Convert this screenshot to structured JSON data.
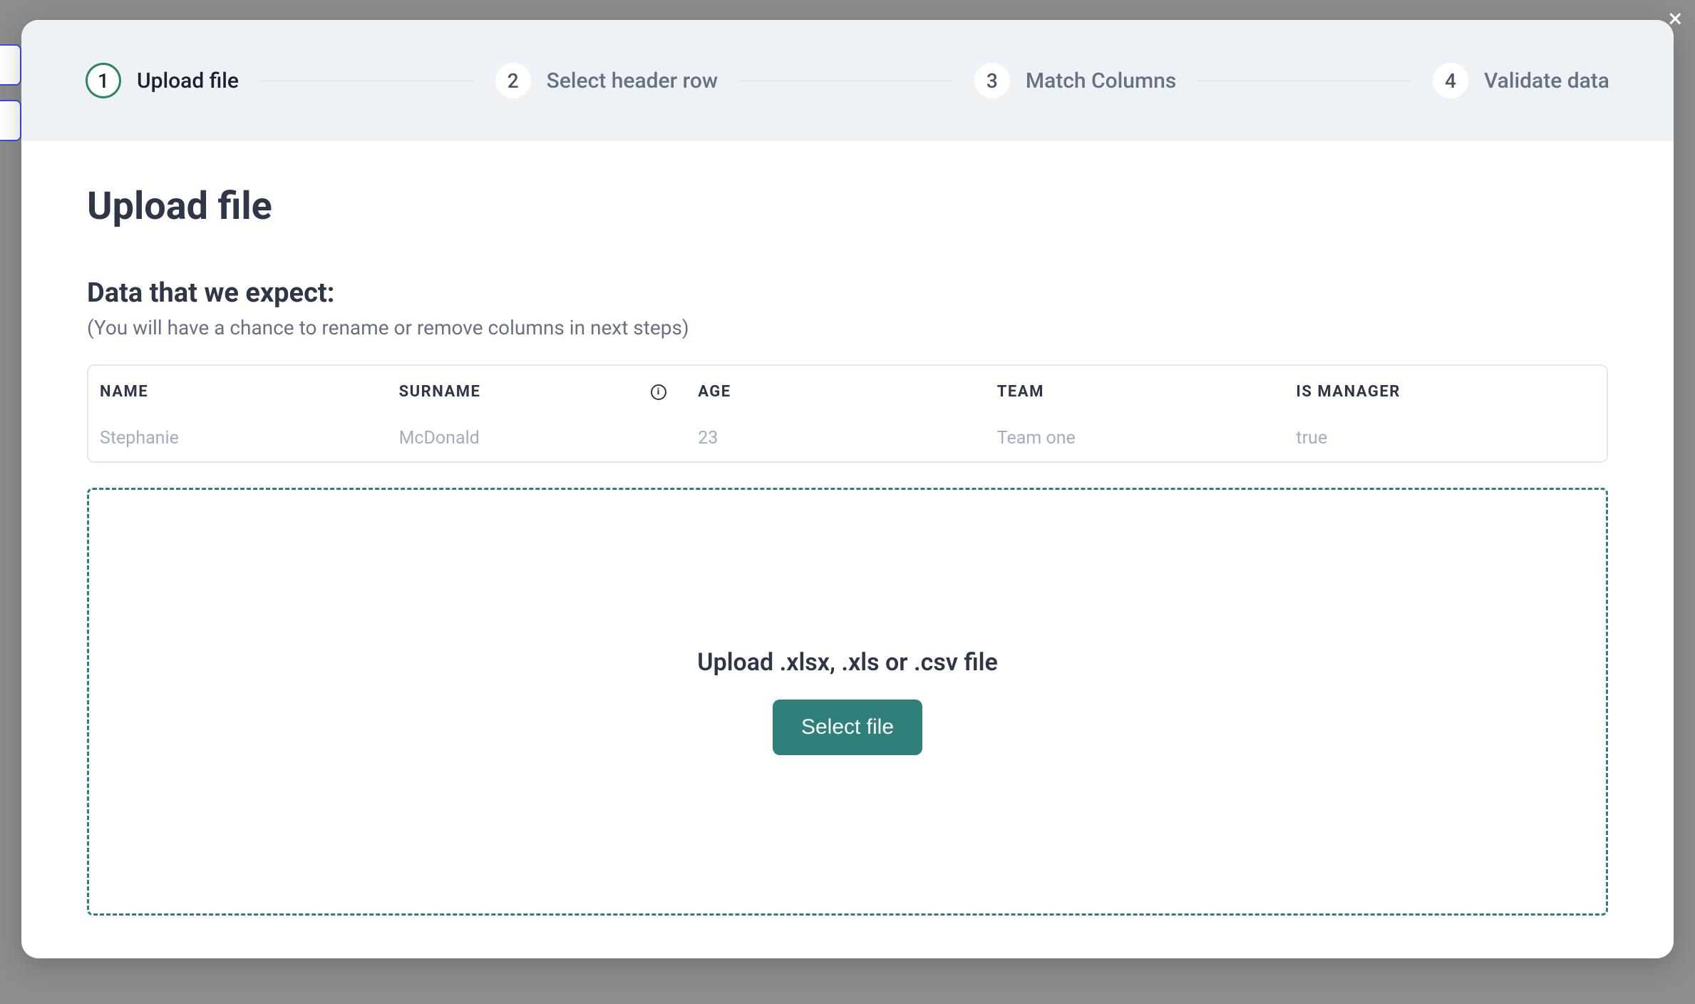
{
  "stepper": {
    "steps": [
      {
        "num": "1",
        "label": "Upload file",
        "active": true
      },
      {
        "num": "2",
        "label": "Select header row",
        "active": false
      },
      {
        "num": "3",
        "label": "Match Columns",
        "active": false
      },
      {
        "num": "4",
        "label": "Validate data",
        "active": false
      }
    ]
  },
  "content": {
    "title": "Upload file",
    "subtitle": "Data that we expect:",
    "helper": "(You will have a chance to rename or remove columns in next steps)",
    "columns": [
      {
        "header": "NAME",
        "example": "Stephanie",
        "has_info": false
      },
      {
        "header": "SURNAME",
        "example": "McDonald",
        "has_info": true
      },
      {
        "header": "AGE",
        "example": "23",
        "has_info": false
      },
      {
        "header": "TEAM",
        "example": "Team one",
        "has_info": false
      },
      {
        "header": "IS MANAGER",
        "example": "true",
        "has_info": false
      }
    ],
    "dropzone": {
      "instruction": "Upload .xlsx, .xls or .csv file",
      "button_label": "Select file"
    }
  },
  "colors": {
    "accent": "#2f7f7a",
    "step_active_border": "#2f855a"
  }
}
